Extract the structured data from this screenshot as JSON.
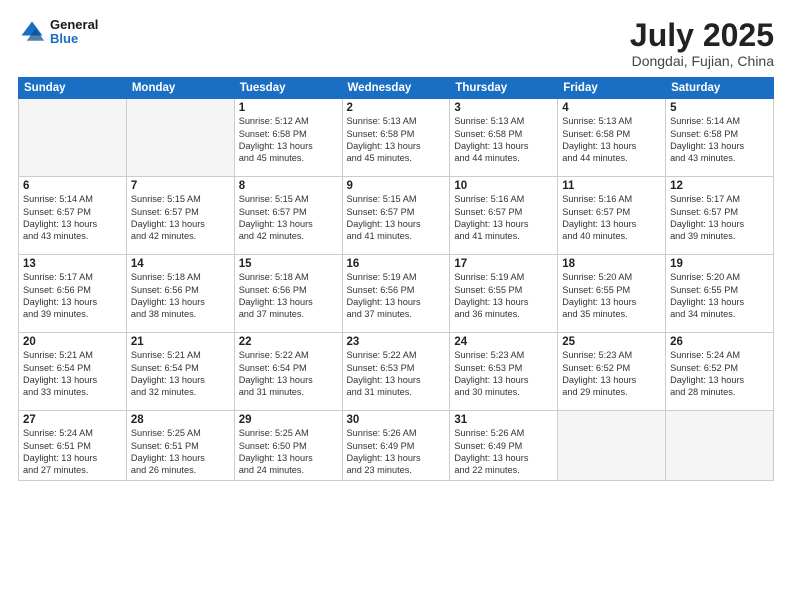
{
  "header": {
    "logo_general": "General",
    "logo_blue": "Blue",
    "month_year": "July 2025",
    "location": "Dongdai, Fujian, China"
  },
  "weekdays": [
    "Sunday",
    "Monday",
    "Tuesday",
    "Wednesday",
    "Thursday",
    "Friday",
    "Saturday"
  ],
  "weeks": [
    [
      {
        "day": "",
        "info": ""
      },
      {
        "day": "",
        "info": ""
      },
      {
        "day": "1",
        "info": "Sunrise: 5:12 AM\nSunset: 6:58 PM\nDaylight: 13 hours\nand 45 minutes."
      },
      {
        "day": "2",
        "info": "Sunrise: 5:13 AM\nSunset: 6:58 PM\nDaylight: 13 hours\nand 45 minutes."
      },
      {
        "day": "3",
        "info": "Sunrise: 5:13 AM\nSunset: 6:58 PM\nDaylight: 13 hours\nand 44 minutes."
      },
      {
        "day": "4",
        "info": "Sunrise: 5:13 AM\nSunset: 6:58 PM\nDaylight: 13 hours\nand 44 minutes."
      },
      {
        "day": "5",
        "info": "Sunrise: 5:14 AM\nSunset: 6:58 PM\nDaylight: 13 hours\nand 43 minutes."
      }
    ],
    [
      {
        "day": "6",
        "info": "Sunrise: 5:14 AM\nSunset: 6:57 PM\nDaylight: 13 hours\nand 43 minutes."
      },
      {
        "day": "7",
        "info": "Sunrise: 5:15 AM\nSunset: 6:57 PM\nDaylight: 13 hours\nand 42 minutes."
      },
      {
        "day": "8",
        "info": "Sunrise: 5:15 AM\nSunset: 6:57 PM\nDaylight: 13 hours\nand 42 minutes."
      },
      {
        "day": "9",
        "info": "Sunrise: 5:15 AM\nSunset: 6:57 PM\nDaylight: 13 hours\nand 41 minutes."
      },
      {
        "day": "10",
        "info": "Sunrise: 5:16 AM\nSunset: 6:57 PM\nDaylight: 13 hours\nand 41 minutes."
      },
      {
        "day": "11",
        "info": "Sunrise: 5:16 AM\nSunset: 6:57 PM\nDaylight: 13 hours\nand 40 minutes."
      },
      {
        "day": "12",
        "info": "Sunrise: 5:17 AM\nSunset: 6:57 PM\nDaylight: 13 hours\nand 39 minutes."
      }
    ],
    [
      {
        "day": "13",
        "info": "Sunrise: 5:17 AM\nSunset: 6:56 PM\nDaylight: 13 hours\nand 39 minutes."
      },
      {
        "day": "14",
        "info": "Sunrise: 5:18 AM\nSunset: 6:56 PM\nDaylight: 13 hours\nand 38 minutes."
      },
      {
        "day": "15",
        "info": "Sunrise: 5:18 AM\nSunset: 6:56 PM\nDaylight: 13 hours\nand 37 minutes."
      },
      {
        "day": "16",
        "info": "Sunrise: 5:19 AM\nSunset: 6:56 PM\nDaylight: 13 hours\nand 37 minutes."
      },
      {
        "day": "17",
        "info": "Sunrise: 5:19 AM\nSunset: 6:55 PM\nDaylight: 13 hours\nand 36 minutes."
      },
      {
        "day": "18",
        "info": "Sunrise: 5:20 AM\nSunset: 6:55 PM\nDaylight: 13 hours\nand 35 minutes."
      },
      {
        "day": "19",
        "info": "Sunrise: 5:20 AM\nSunset: 6:55 PM\nDaylight: 13 hours\nand 34 minutes."
      }
    ],
    [
      {
        "day": "20",
        "info": "Sunrise: 5:21 AM\nSunset: 6:54 PM\nDaylight: 13 hours\nand 33 minutes."
      },
      {
        "day": "21",
        "info": "Sunrise: 5:21 AM\nSunset: 6:54 PM\nDaylight: 13 hours\nand 32 minutes."
      },
      {
        "day": "22",
        "info": "Sunrise: 5:22 AM\nSunset: 6:54 PM\nDaylight: 13 hours\nand 31 minutes."
      },
      {
        "day": "23",
        "info": "Sunrise: 5:22 AM\nSunset: 6:53 PM\nDaylight: 13 hours\nand 31 minutes."
      },
      {
        "day": "24",
        "info": "Sunrise: 5:23 AM\nSunset: 6:53 PM\nDaylight: 13 hours\nand 30 minutes."
      },
      {
        "day": "25",
        "info": "Sunrise: 5:23 AM\nSunset: 6:52 PM\nDaylight: 13 hours\nand 29 minutes."
      },
      {
        "day": "26",
        "info": "Sunrise: 5:24 AM\nSunset: 6:52 PM\nDaylight: 13 hours\nand 28 minutes."
      }
    ],
    [
      {
        "day": "27",
        "info": "Sunrise: 5:24 AM\nSunset: 6:51 PM\nDaylight: 13 hours\nand 27 minutes."
      },
      {
        "day": "28",
        "info": "Sunrise: 5:25 AM\nSunset: 6:51 PM\nDaylight: 13 hours\nand 26 minutes."
      },
      {
        "day": "29",
        "info": "Sunrise: 5:25 AM\nSunset: 6:50 PM\nDaylight: 13 hours\nand 24 minutes."
      },
      {
        "day": "30",
        "info": "Sunrise: 5:26 AM\nSunset: 6:49 PM\nDaylight: 13 hours\nand 23 minutes."
      },
      {
        "day": "31",
        "info": "Sunrise: 5:26 AM\nSunset: 6:49 PM\nDaylight: 13 hours\nand 22 minutes."
      },
      {
        "day": "",
        "info": ""
      },
      {
        "day": "",
        "info": ""
      }
    ]
  ]
}
